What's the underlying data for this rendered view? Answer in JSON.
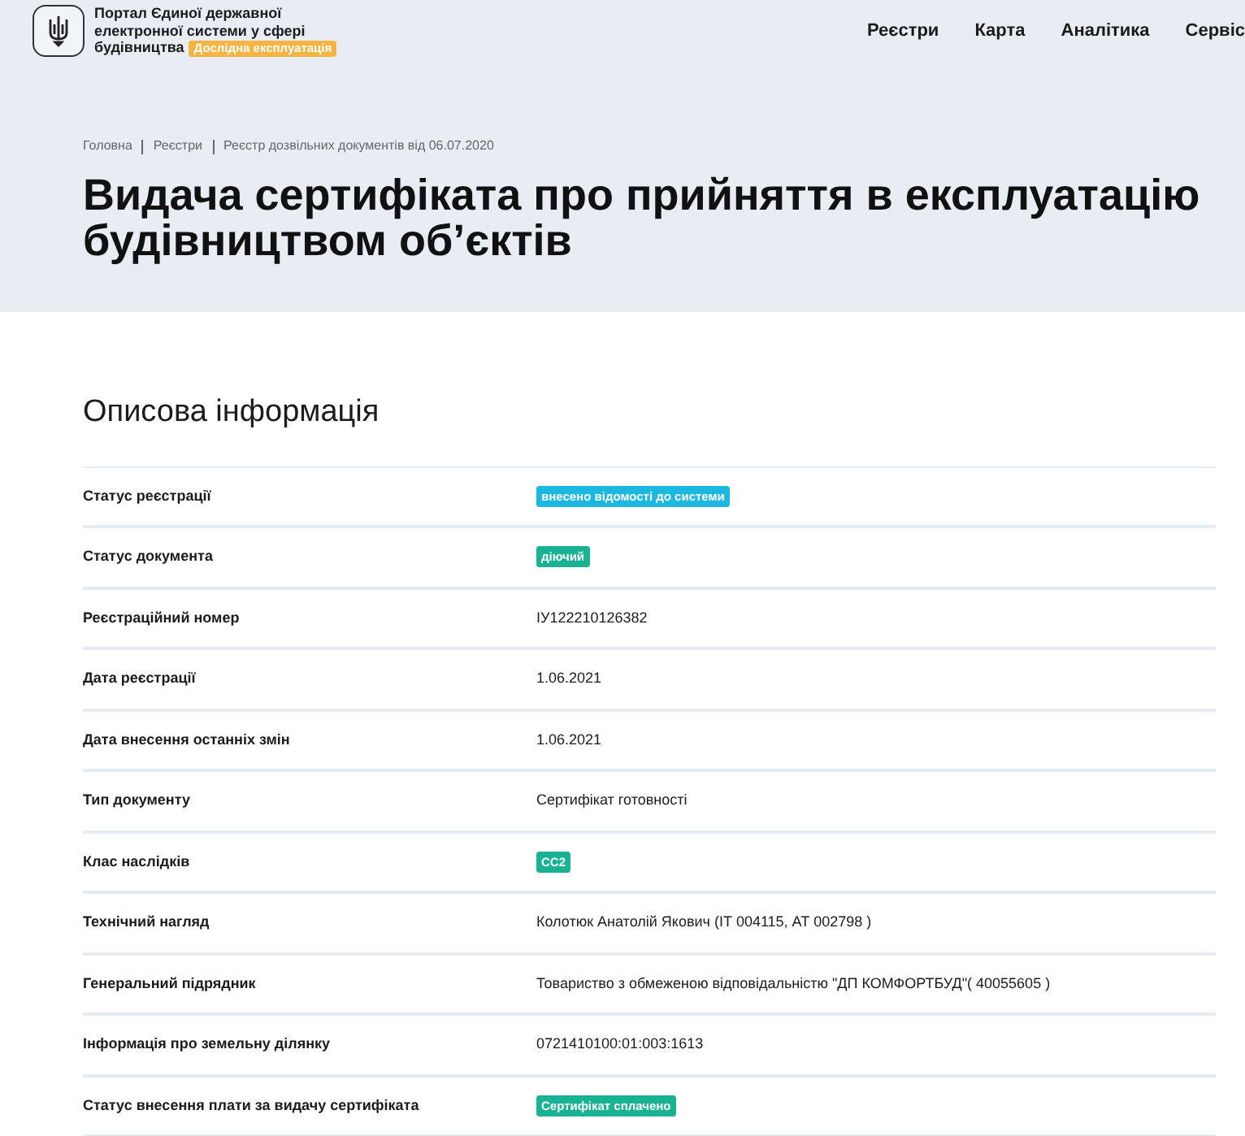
{
  "header": {
    "portal_title_lines": [
      "Портал Єдиної державної",
      "електронної системи у сфері",
      "будівництва"
    ],
    "badge": "Дослідна експлуатація",
    "nav": [
      "Реєстри",
      "Карта",
      "Аналітика",
      "Сервіс"
    ]
  },
  "breadcrumbs": [
    "Головна",
    "Реєстри",
    "Реєстр дозвільних документів від 06.07.2020"
  ],
  "title": "Видача сертифіката про прийняття в експлуатацію будівництвом об’єктів",
  "section_title": "Описова інформація",
  "rows": [
    {
      "label": "Статус реєстрації",
      "kind": "badge",
      "value": "внесено відомості до системи",
      "color": "#1cb8e0"
    },
    {
      "label": "Статус документа",
      "kind": "badge",
      "value": "діючий",
      "color": "#19b394"
    },
    {
      "label": "Реєстраційний номер",
      "kind": "text",
      "value": "ІУ122210126382"
    },
    {
      "label": "Дата реєстрації",
      "kind": "text",
      "value": "1.06.2021"
    },
    {
      "label": "Дата внесення останніх змін",
      "kind": "text",
      "value": "1.06.2021"
    },
    {
      "label": "Тип документу",
      "kind": "text",
      "value": "Сертифікат готовності"
    },
    {
      "label": "Клас наслідків",
      "kind": "badge",
      "value": "СС2",
      "color": "#19b394"
    },
    {
      "label": "Технічний нагляд",
      "kind": "text",
      "value": "Колотюк Анатолій Якович (ІТ 004115, АТ 002798 )"
    },
    {
      "label": "Генеральний підрядник",
      "kind": "text",
      "value": "Товариство з обмеженою відповідальністю \"ДП КОМФОРТБУД\"( 40055605 )"
    },
    {
      "label": "Інформація про земельну ділянку",
      "kind": "text",
      "value": "0721410100:01:003:1613"
    },
    {
      "label": "Статус внесення плати за видачу сертифіката",
      "kind": "badge",
      "value": "Сертифікат сплачено",
      "color": "#19b394"
    }
  ]
}
